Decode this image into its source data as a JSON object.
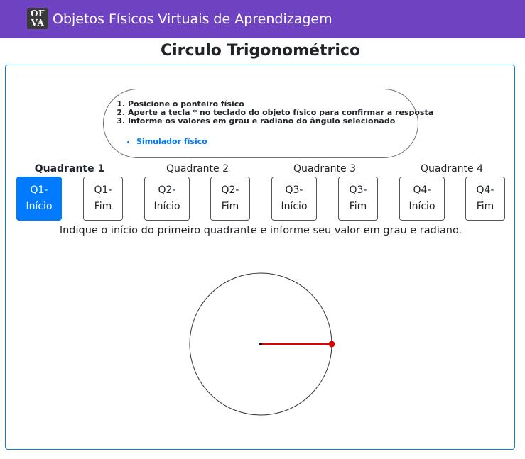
{
  "header": {
    "logo_line1": "OF",
    "logo_line2": "VA",
    "brand": "Objetos Físicos Virtuais de Aprendizagem"
  },
  "page_title": "Circulo Trigonométrico",
  "instructions": {
    "steps": [
      "Posicione o ponteiro físico",
      "Aperte a tecla * no teclado do objeto físico para confirmar a resposta",
      "Informe os valores em grau e radiano do ângulo selecionado"
    ],
    "link_label": "Simulador físico"
  },
  "quadrants": [
    {
      "label": "Quadrante 1",
      "active": true
    },
    {
      "label": "Quadrante 2",
      "active": false
    },
    {
      "label": "Quadrante 3",
      "active": false
    },
    {
      "label": "Quadrante 4",
      "active": false
    }
  ],
  "buttons": [
    {
      "line1": "Q1-",
      "line2": "Início",
      "active": true
    },
    {
      "line1": "Q1-",
      "line2": "Fim",
      "active": false
    },
    {
      "line1": "Q2-",
      "line2": "Início",
      "active": false
    },
    {
      "line1": "Q2-",
      "line2": "Fim",
      "active": false
    },
    {
      "line1": "Q3-",
      "line2": "Início",
      "active": false
    },
    {
      "line1": "Q3-",
      "line2": "Fim",
      "active": false
    },
    {
      "line1": "Q4-",
      "line2": "Início",
      "active": false
    },
    {
      "line1": "Q4-",
      "line2": "Fim",
      "active": false
    }
  ],
  "prompt": "Indique o início do primeiro quadrante e informe seu valor em grau e radiano.",
  "pointer": {
    "angle_degrees": 0,
    "color": "#e00000"
  },
  "colors": {
    "navbar": "#6f42c1",
    "active_button": "#007bff",
    "card_border": "#0d7ec4"
  }
}
